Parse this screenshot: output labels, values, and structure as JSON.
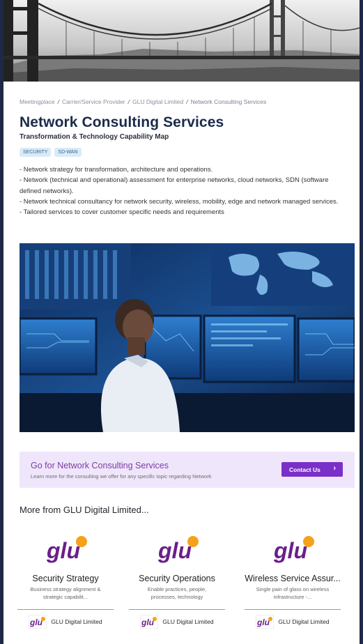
{
  "breadcrumb": [
    "Meetingplace",
    "Carrier/Service Provider",
    "GLU Digital Limited",
    "Network Consulting Services"
  ],
  "title": "Network Consulting Services",
  "subtitle": "Transformation & Technology Capability Map",
  "tags": [
    "SECURITY",
    "SD-WAN"
  ],
  "description": [
    "- Network strategy for transformation, architecture and operations.",
    "- Network (technical and operational) assessment for enterprise networks, cloud networks, SDN (software defined networks).",
    "- Network technical consultancy for network security, wireless, mobility, edge and network managed services.",
    "- Tailored services to cover customer specific needs and requirements"
  ],
  "cta": {
    "title": "Go for Network Consulting Services",
    "subtitle": "Learn more for the consulting we offer for any specific topic regarding Network",
    "button_label": "Contact Us",
    "button_icon": "chevron-right-icon"
  },
  "more_title": "More from GLU Digital Limited...",
  "logo_text": "glu",
  "cards": [
    {
      "title": "Security Strategy",
      "desc": "Business strategy alignment & strategic capabilit...",
      "company": "GLU Digital Limited"
    },
    {
      "title": "Security Operations",
      "desc": "Enable practices, people, processes, technology",
      "company": "GLU Digital Limited"
    },
    {
      "title": "Wireless Service Assur...",
      "desc": "Single pain of glass on wireless infrastructure -...",
      "company": "GLU Digital Limited"
    }
  ],
  "colors": {
    "accent": "#7b2fc9",
    "brand_purple": "#6a1f8a",
    "brand_orange": "#f5a21b",
    "title": "#1a2b4a",
    "cta_bg": "#efe6fb"
  }
}
